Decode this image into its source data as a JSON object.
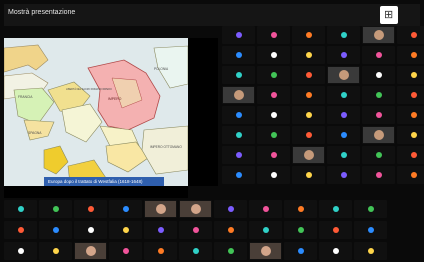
{
  "app": {
    "title": "Mostrà presentazione",
    "grid_icon": "grid-view-icon"
  },
  "presentation": {
    "map_caption": "Europa dopo il trattato di Westfalia (1618-1648)",
    "map_labels": [
      "FRANCIA",
      "SPAGNA",
      "IMPERO",
      "POLONIA",
      "LIBERTÀ DEL SACRO ROMANO IMPERO",
      "IMPERO OTTOMANO"
    ]
  },
  "participant_tiles": {
    "avatar_colors": [
      "#7c5cff",
      "#f1549b",
      "#ff7b24",
      "#30d1c7",
      "#42c457",
      "#ff5a36",
      "#2b8cff",
      "#ffffff",
      "#ffd54a"
    ]
  }
}
